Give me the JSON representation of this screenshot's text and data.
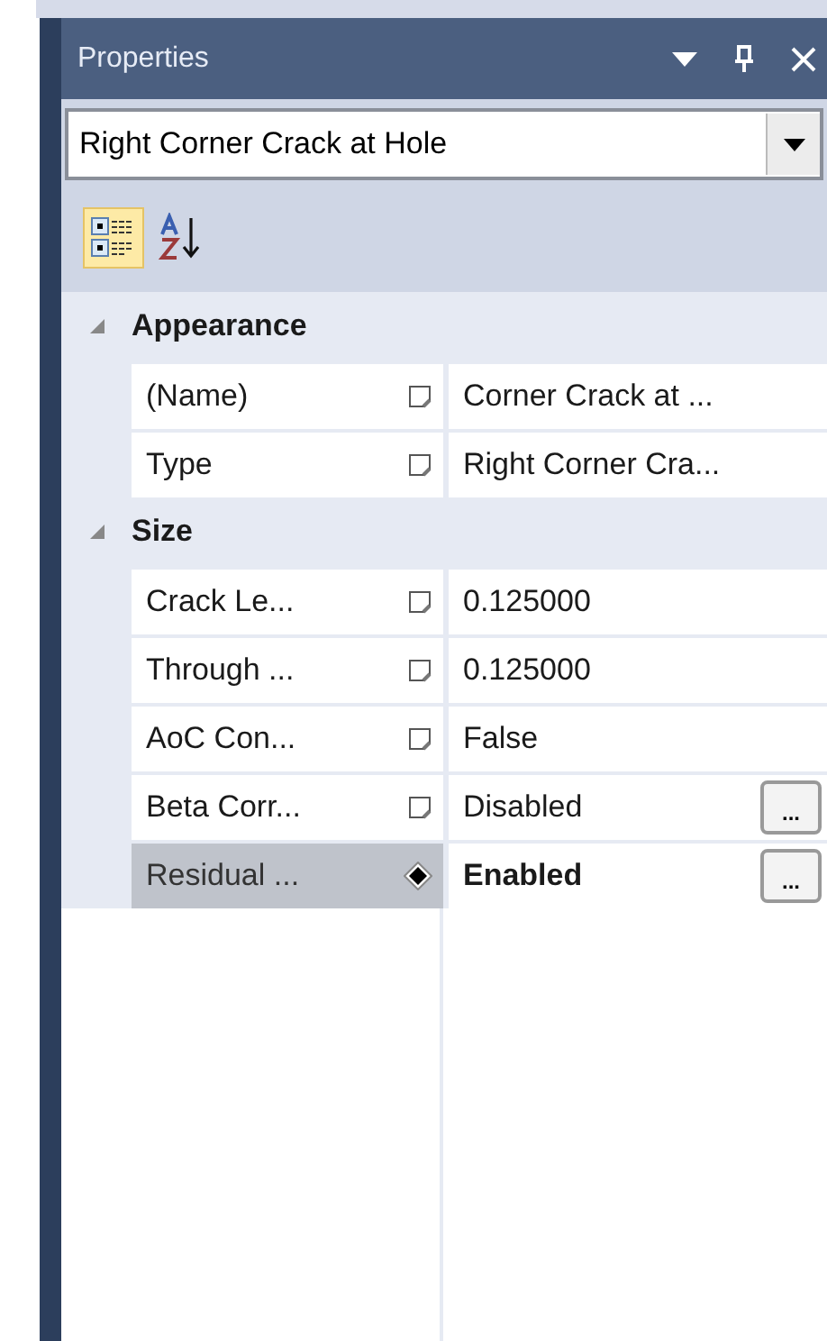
{
  "panel": {
    "title": "Properties"
  },
  "object_selector": {
    "value": "Right Corner Crack at Hole"
  },
  "toolbar": [
    {
      "kind": "categorized",
      "selected": true
    },
    {
      "kind": "alphabetical",
      "selected": false
    }
  ],
  "categories": [
    {
      "name": "Appearance",
      "expanded": true,
      "properties": [
        {
          "name": "(Name)",
          "kind": "page",
          "value": "Corner Crack at ...",
          "modified": false,
          "selected": false
        },
        {
          "name": "Type",
          "kind": "page",
          "value": "Right Corner Cra...",
          "modified": false,
          "selected": false
        }
      ]
    },
    {
      "name": "Size",
      "expanded": true,
      "properties": [
        {
          "name": "Crack Le...",
          "kind": "page",
          "value": "0.125000",
          "modified": false,
          "selected": false
        },
        {
          "name": "Through ...",
          "kind": "page",
          "value": "0.125000",
          "modified": false,
          "selected": false
        },
        {
          "name": "AoC Con...",
          "kind": "page",
          "value": "False",
          "modified": false,
          "selected": false
        },
        {
          "name": "Beta Corr...",
          "kind": "page",
          "value": "Disabled",
          "modified": false,
          "selected": false,
          "editor_button": "..."
        },
        {
          "name": "Residual ...",
          "kind": "diamond",
          "value": "Enabled",
          "modified": true,
          "selected": true,
          "editor_button": "..."
        }
      ]
    }
  ]
}
